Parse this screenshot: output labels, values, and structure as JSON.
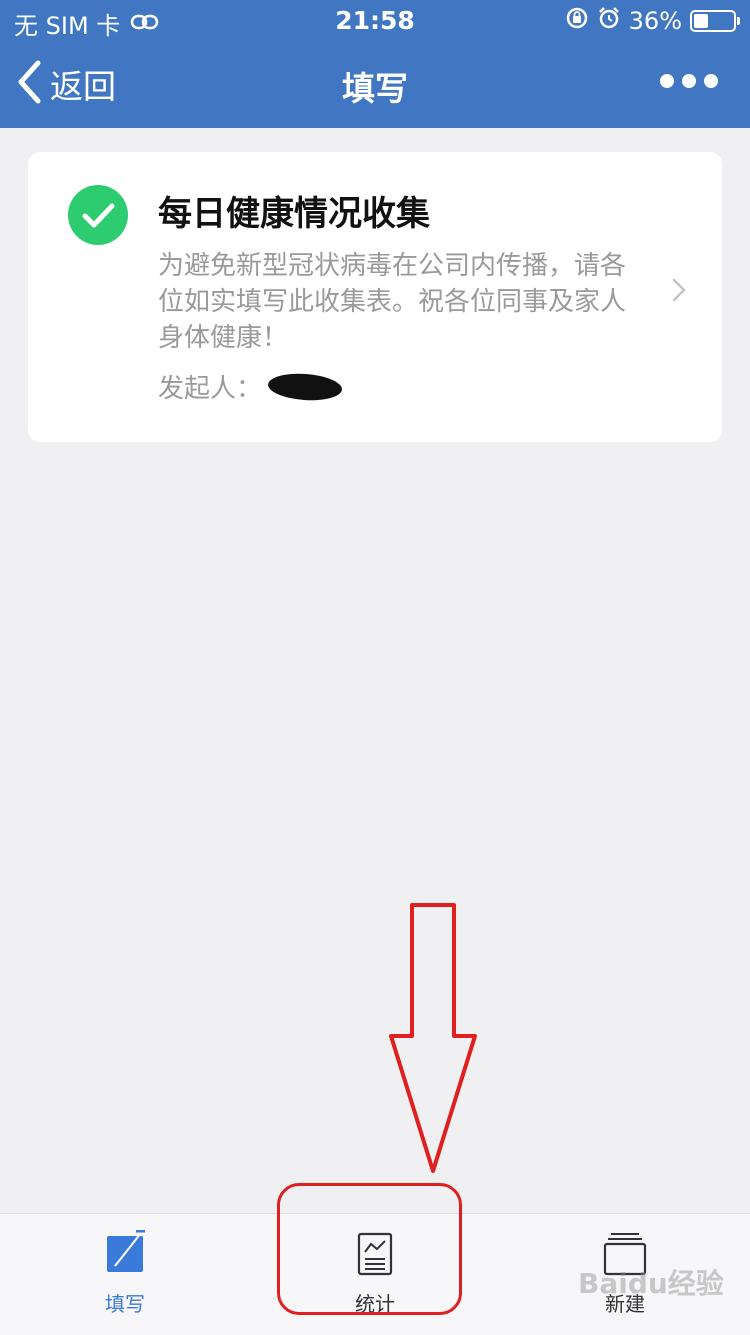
{
  "status_bar": {
    "carrier": "无 SIM 卡",
    "time": "21:58",
    "battery_percent_label": "36%",
    "battery_level": 0.36
  },
  "nav": {
    "back_label": "返回",
    "title": "填写"
  },
  "card": {
    "title": "每日健康情况收集",
    "description": "为避免新型冠状病毒在公司内传播，请各位如实填写此收集表。祝各位同事及家人身体健康！",
    "initiator_label": "发起人："
  },
  "tabs": [
    {
      "label": "填写",
      "icon": "edit-icon",
      "active": true
    },
    {
      "label": "统计",
      "icon": "stats-icon",
      "active": false
    },
    {
      "label": "新建",
      "icon": "new-icon",
      "active": false
    }
  ],
  "watermark": "Baidu经验",
  "colors": {
    "header": "#4177c2",
    "accent": "#3a7ad9",
    "check": "#2ecc71",
    "annotation": "#e02020"
  }
}
